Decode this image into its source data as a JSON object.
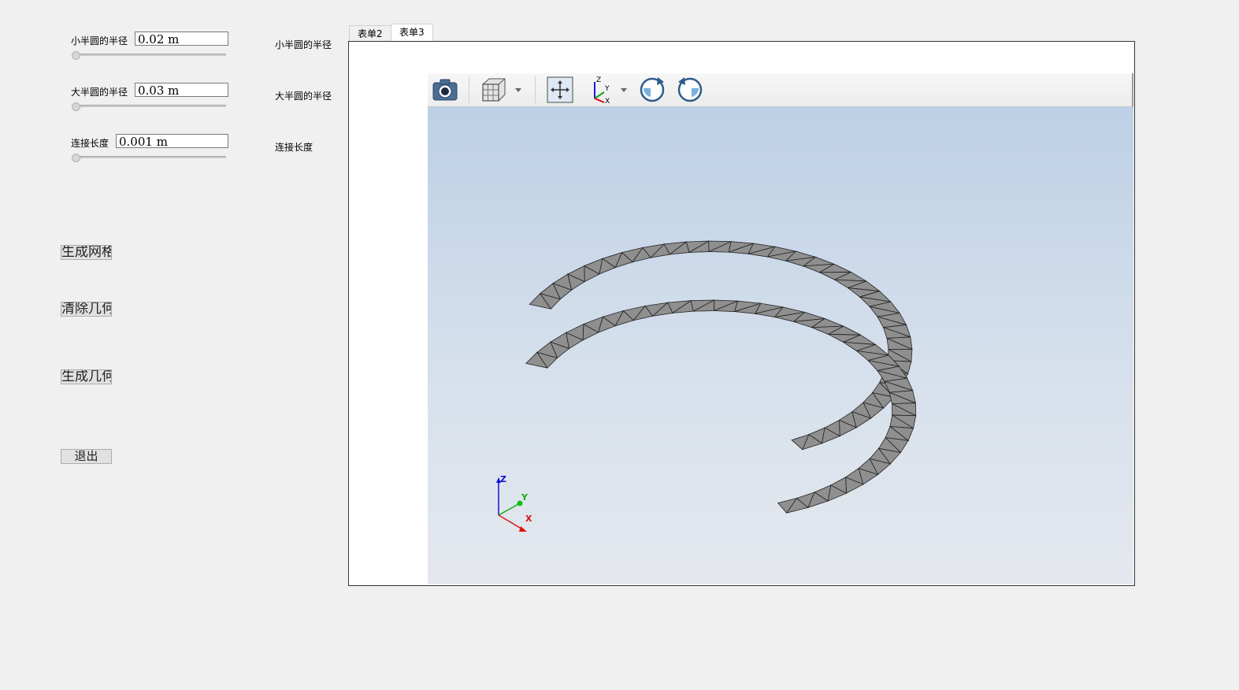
{
  "params": [
    {
      "label": "小半圆的半径",
      "value": "0.02 m",
      "side_label": "小半圆的半径"
    },
    {
      "label": "大半圆的半径",
      "value": "0.03 m",
      "side_label": "大半圆的半径"
    },
    {
      "label": "连接长度",
      "value": "0.001 m",
      "side_label": "连接长度"
    }
  ],
  "buttons": {
    "generate_mesh": "生成网格",
    "clear_geometry": "清除几何",
    "generate_geometry": "生成几何",
    "exit": "退出"
  },
  "tabs": [
    {
      "label": "表单2",
      "active": false
    },
    {
      "label": "表单3",
      "active": true
    }
  ],
  "toolbar": {
    "icons": [
      "camera-icon",
      "cube-view-icon",
      "fit-all-icon",
      "axes-orientation-icon",
      "rotate-cw-icon",
      "rotate-ccw-icon"
    ]
  },
  "axes_triad": {
    "x": "X",
    "y": "Y",
    "z": "Z"
  },
  "colors": {
    "mesh_fill": "#8f8f8f",
    "viewport_top": "#bdd0e6",
    "viewport_bottom": "#e5e8ee",
    "axis_x": "#e01010",
    "axis_y": "#10c010",
    "axis_z": "#1010d0"
  }
}
